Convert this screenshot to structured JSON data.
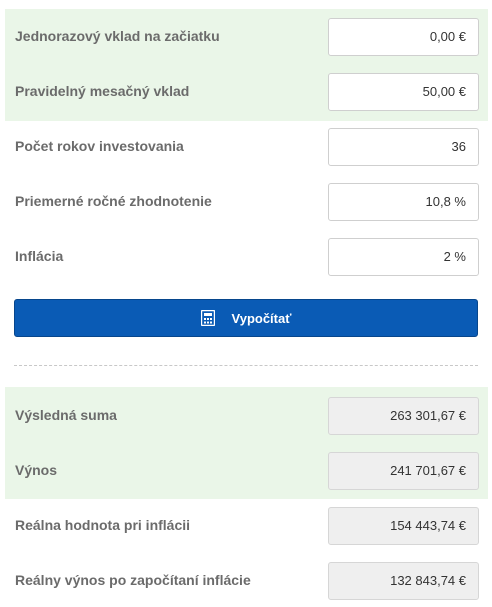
{
  "inputs": [
    {
      "label": "Jednorazový vklad na začiatku",
      "value": "0,00 €"
    },
    {
      "label": "Pravidelný mesačný vklad",
      "value": "50,00 €"
    },
    {
      "label": "Počet rokov investovania",
      "value": "36"
    },
    {
      "label": "Priemerné ročné zhodnotenie",
      "value": "10,8 %"
    },
    {
      "label": "Inflácia",
      "value": "2 %"
    }
  ],
  "button": {
    "label": "Vypočítať",
    "icon": "calculator-icon"
  },
  "results": [
    {
      "label": "Výsledná suma",
      "value": "263 301,67 €"
    },
    {
      "label": "Výnos",
      "value": "241 701,67 €"
    },
    {
      "label": "Reálna hodnota pri inflácii",
      "value": "154 443,74 €"
    },
    {
      "label": "Reálny výnos po započítaní inflácie",
      "value": "132 843,74 €"
    }
  ],
  "colors": {
    "accent": "#0a5bb5",
    "highlight_band": "#eaf6e8",
    "readonly_field": "#efefef"
  }
}
